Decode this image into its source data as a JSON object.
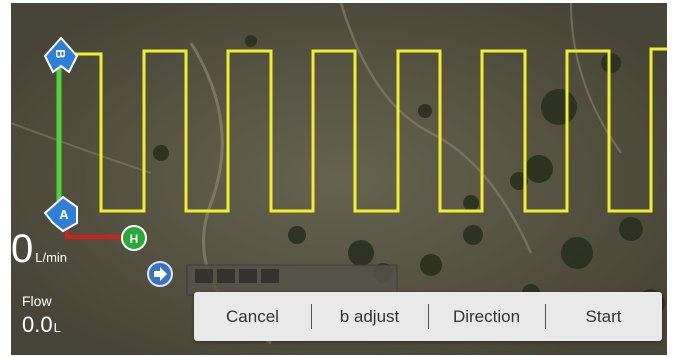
{
  "map": {
    "marker_a": "A",
    "marker_b": "B",
    "marker_h": "H",
    "colors": {
      "route": "#f0f02a",
      "ab_line": "#4fd43a",
      "home_line": "#d0201c",
      "marker_blue": "#2f7fd8",
      "home_green": "#2aa83a",
      "button_bg": "#e9e9e9"
    },
    "icons": [
      "navigate-icon"
    ]
  },
  "flow": {
    "rate_value": "0",
    "rate_unit": "L/min",
    "label": "Flow",
    "value": "0.0",
    "unit": "L"
  },
  "actions": {
    "cancel": "Cancel",
    "b_adjust": "b adjust",
    "direction": "Direction",
    "start": "Start"
  }
}
